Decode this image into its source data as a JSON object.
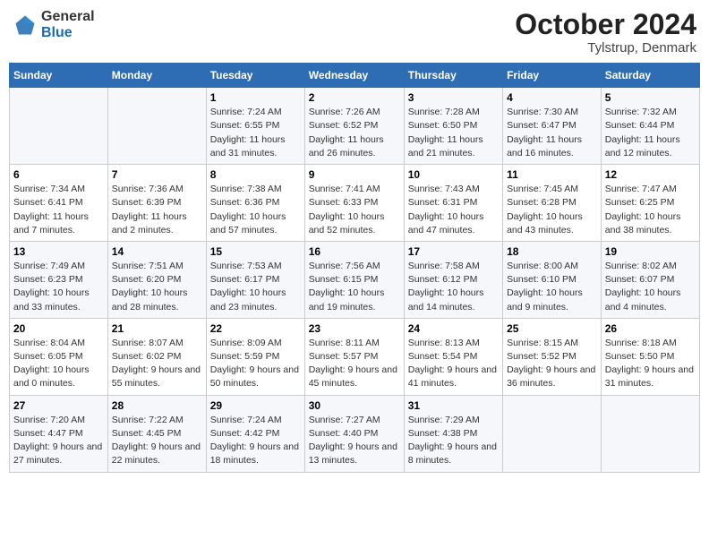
{
  "header": {
    "logo_general": "General",
    "logo_blue": "Blue",
    "month": "October 2024",
    "location": "Tylstrup, Denmark"
  },
  "weekdays": [
    "Sunday",
    "Monday",
    "Tuesday",
    "Wednesday",
    "Thursday",
    "Friday",
    "Saturday"
  ],
  "weeks": [
    [
      {
        "day": "",
        "detail": ""
      },
      {
        "day": "",
        "detail": ""
      },
      {
        "day": "1",
        "detail": "Sunrise: 7:24 AM\nSunset: 6:55 PM\nDaylight: 11 hours and 31 minutes."
      },
      {
        "day": "2",
        "detail": "Sunrise: 7:26 AM\nSunset: 6:52 PM\nDaylight: 11 hours and 26 minutes."
      },
      {
        "day": "3",
        "detail": "Sunrise: 7:28 AM\nSunset: 6:50 PM\nDaylight: 11 hours and 21 minutes."
      },
      {
        "day": "4",
        "detail": "Sunrise: 7:30 AM\nSunset: 6:47 PM\nDaylight: 11 hours and 16 minutes."
      },
      {
        "day": "5",
        "detail": "Sunrise: 7:32 AM\nSunset: 6:44 PM\nDaylight: 11 hours and 12 minutes."
      }
    ],
    [
      {
        "day": "6",
        "detail": "Sunrise: 7:34 AM\nSunset: 6:41 PM\nDaylight: 11 hours and 7 minutes."
      },
      {
        "day": "7",
        "detail": "Sunrise: 7:36 AM\nSunset: 6:39 PM\nDaylight: 11 hours and 2 minutes."
      },
      {
        "day": "8",
        "detail": "Sunrise: 7:38 AM\nSunset: 6:36 PM\nDaylight: 10 hours and 57 minutes."
      },
      {
        "day": "9",
        "detail": "Sunrise: 7:41 AM\nSunset: 6:33 PM\nDaylight: 10 hours and 52 minutes."
      },
      {
        "day": "10",
        "detail": "Sunrise: 7:43 AM\nSunset: 6:31 PM\nDaylight: 10 hours and 47 minutes."
      },
      {
        "day": "11",
        "detail": "Sunrise: 7:45 AM\nSunset: 6:28 PM\nDaylight: 10 hours and 43 minutes."
      },
      {
        "day": "12",
        "detail": "Sunrise: 7:47 AM\nSunset: 6:25 PM\nDaylight: 10 hours and 38 minutes."
      }
    ],
    [
      {
        "day": "13",
        "detail": "Sunrise: 7:49 AM\nSunset: 6:23 PM\nDaylight: 10 hours and 33 minutes."
      },
      {
        "day": "14",
        "detail": "Sunrise: 7:51 AM\nSunset: 6:20 PM\nDaylight: 10 hours and 28 minutes."
      },
      {
        "day": "15",
        "detail": "Sunrise: 7:53 AM\nSunset: 6:17 PM\nDaylight: 10 hours and 23 minutes."
      },
      {
        "day": "16",
        "detail": "Sunrise: 7:56 AM\nSunset: 6:15 PM\nDaylight: 10 hours and 19 minutes."
      },
      {
        "day": "17",
        "detail": "Sunrise: 7:58 AM\nSunset: 6:12 PM\nDaylight: 10 hours and 14 minutes."
      },
      {
        "day": "18",
        "detail": "Sunrise: 8:00 AM\nSunset: 6:10 PM\nDaylight: 10 hours and 9 minutes."
      },
      {
        "day": "19",
        "detail": "Sunrise: 8:02 AM\nSunset: 6:07 PM\nDaylight: 10 hours and 4 minutes."
      }
    ],
    [
      {
        "day": "20",
        "detail": "Sunrise: 8:04 AM\nSunset: 6:05 PM\nDaylight: 10 hours and 0 minutes."
      },
      {
        "day": "21",
        "detail": "Sunrise: 8:07 AM\nSunset: 6:02 PM\nDaylight: 9 hours and 55 minutes."
      },
      {
        "day": "22",
        "detail": "Sunrise: 8:09 AM\nSunset: 5:59 PM\nDaylight: 9 hours and 50 minutes."
      },
      {
        "day": "23",
        "detail": "Sunrise: 8:11 AM\nSunset: 5:57 PM\nDaylight: 9 hours and 45 minutes."
      },
      {
        "day": "24",
        "detail": "Sunrise: 8:13 AM\nSunset: 5:54 PM\nDaylight: 9 hours and 41 minutes."
      },
      {
        "day": "25",
        "detail": "Sunrise: 8:15 AM\nSunset: 5:52 PM\nDaylight: 9 hours and 36 minutes."
      },
      {
        "day": "26",
        "detail": "Sunrise: 8:18 AM\nSunset: 5:50 PM\nDaylight: 9 hours and 31 minutes."
      }
    ],
    [
      {
        "day": "27",
        "detail": "Sunrise: 7:20 AM\nSunset: 4:47 PM\nDaylight: 9 hours and 27 minutes."
      },
      {
        "day": "28",
        "detail": "Sunrise: 7:22 AM\nSunset: 4:45 PM\nDaylight: 9 hours and 22 minutes."
      },
      {
        "day": "29",
        "detail": "Sunrise: 7:24 AM\nSunset: 4:42 PM\nDaylight: 9 hours and 18 minutes."
      },
      {
        "day": "30",
        "detail": "Sunrise: 7:27 AM\nSunset: 4:40 PM\nDaylight: 9 hours and 13 minutes."
      },
      {
        "day": "31",
        "detail": "Sunrise: 7:29 AM\nSunset: 4:38 PM\nDaylight: 9 hours and 8 minutes."
      },
      {
        "day": "",
        "detail": ""
      },
      {
        "day": "",
        "detail": ""
      }
    ]
  ]
}
